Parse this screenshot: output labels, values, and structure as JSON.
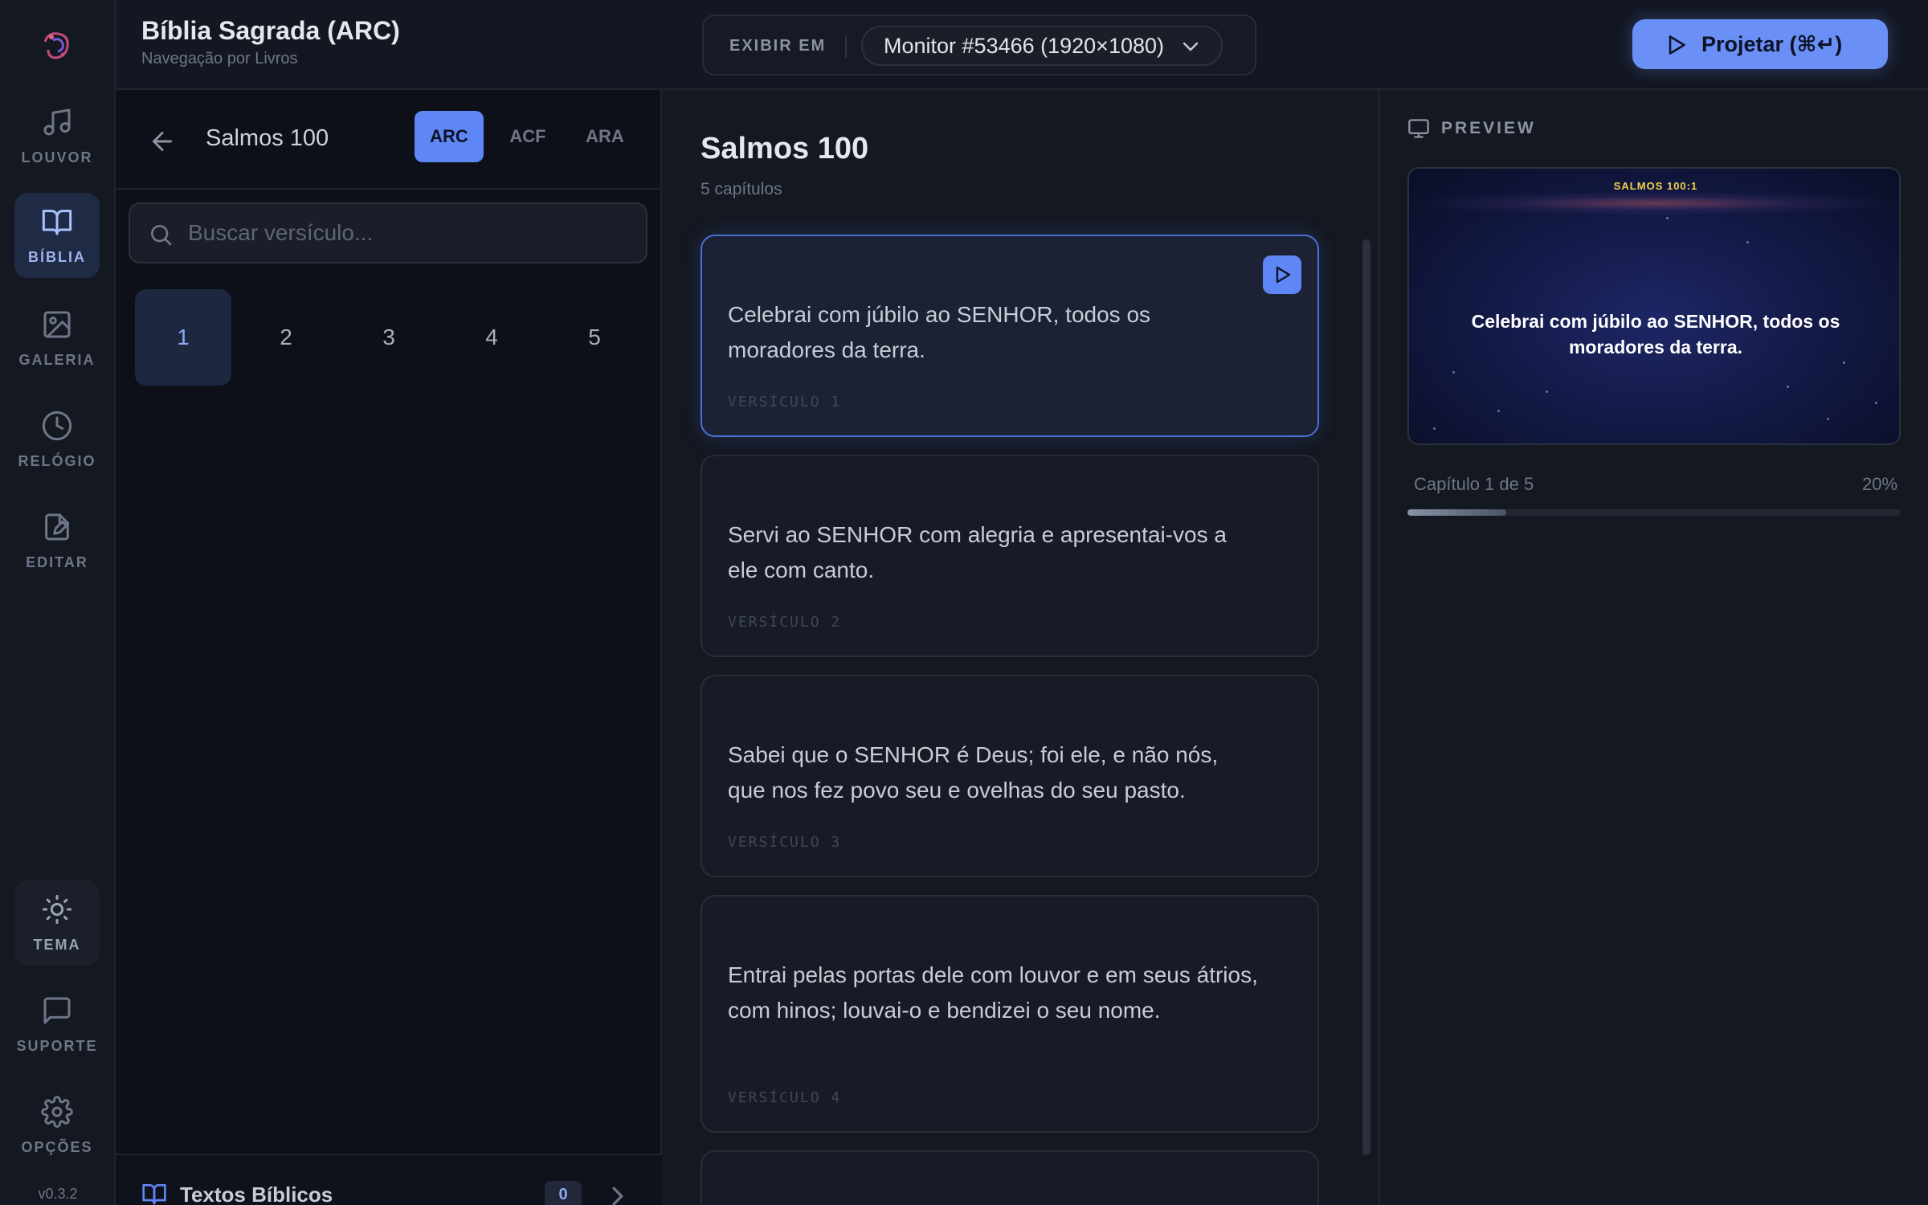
{
  "rail": {
    "items": [
      {
        "label": "LOUVOR",
        "icon": "music-icon"
      },
      {
        "label": "BÍBLIA",
        "icon": "book-icon"
      },
      {
        "label": "GALERIA",
        "icon": "gallery-icon"
      },
      {
        "label": "RELÓGIO",
        "icon": "clock-icon"
      },
      {
        "label": "EDITAR",
        "icon": "edit-icon"
      }
    ],
    "bottom": [
      {
        "label": "TEMA",
        "icon": "sun-icon"
      },
      {
        "label": "SUPORTE",
        "icon": "chat-icon"
      },
      {
        "label": "OPÇÕES",
        "icon": "gear-icon"
      }
    ],
    "version": "v0.3.2"
  },
  "panel": {
    "title": "Bíblia Sagrada (ARC)",
    "subtitle": "Navegação por Livros",
    "chapter_heading": "Salmos 100",
    "versions": [
      "ARC",
      "ACF",
      "ARA"
    ],
    "active_version": "ARC",
    "search_placeholder": "Buscar versículo...",
    "chapters": [
      "1",
      "2",
      "3",
      "4",
      "5"
    ],
    "active_chapter": "1",
    "footer": {
      "label": "Textos Bíblicos",
      "count": "0"
    }
  },
  "topbar": {
    "display_label": "EXIBIR EM",
    "monitor": "Monitor #53466 (1920×1080)",
    "project_label": "Projetar (⌘↵)"
  },
  "main": {
    "title": "Salmos 100",
    "subtitle": "5 capítulos",
    "verses": [
      {
        "text": "Celebrai com júbilo ao SENHOR, todos os moradores da terra.",
        "label": "VERSÍCULO 1"
      },
      {
        "text": "Servi ao SENHOR com alegria e apresentai-vos a ele com canto.",
        "label": "VERSÍCULO 2"
      },
      {
        "text": "Sabei que o SENHOR é Deus; foi ele, e não nós, que nos fez povo seu e ovelhas do seu pasto.",
        "label": "VERSÍCULO 3"
      },
      {
        "text": "Entrai pelas portas dele com louvor e em seus átrios, com hinos; louvai-o e bendizei o seu nome.",
        "label": "VERSÍCULO 4"
      }
    ]
  },
  "preview": {
    "heading": "PREVIEW",
    "reference": "SALMOS 100:1",
    "text": "Celebrai com júbilo ao SENHOR, todos os moradores da terra.",
    "progress_label": "Capítulo 1 de 5",
    "progress_text": "20%",
    "progress_fraction": 0.2
  },
  "colors": {
    "accent": "#5e86f5",
    "background": "#12151d",
    "verse_ref": "#f2d24b"
  }
}
